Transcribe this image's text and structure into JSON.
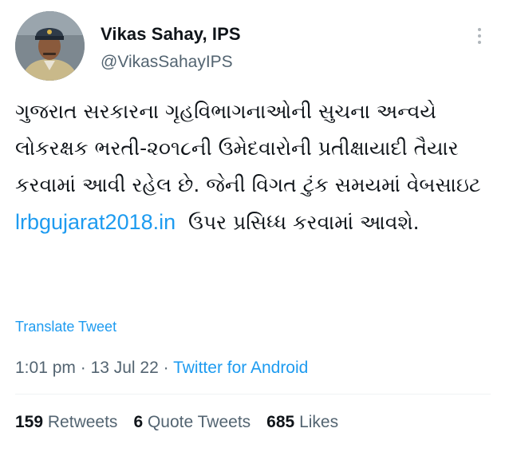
{
  "author": {
    "name": "Vikas Sahay, IPS",
    "handle": "@VikasSahayIPS",
    "avatar_icon": "profile-photo"
  },
  "tweet": {
    "text_before_link": "ગુજરાત સરકારના ગૃહવિભાગનાઓની સુચના અન્વયે લોકરક્ષક ભરતી-૨૦૧૮ની ઉમેદવારોની પ્રતીક્ષાયાદી તૈયાર કરવામાં આવી રહેલ છે. જેની વિગત ટુંક સમયમાં વેબસાઇટ ",
    "link": "lrbgujarat2018.in",
    "text_after_link": "  ઉપર પ્રસિધ્ધ કરવામાં આવશે.",
    "translate_label": "Translate Tweet"
  },
  "meta": {
    "time": "1:01 pm",
    "date": "13 Jul 22",
    "separator": " · ",
    "source": "Twitter for Android"
  },
  "stats": {
    "retweets_count": "159",
    "retweets_label": "Retweets",
    "quotes_count": "6",
    "quotes_label": "Quote Tweets",
    "likes_count": "685",
    "likes_label": "Likes"
  },
  "colors": {
    "link": "#1d9bf0",
    "text": "#0f1419",
    "muted": "#536471",
    "divider": "#eff3f4"
  }
}
